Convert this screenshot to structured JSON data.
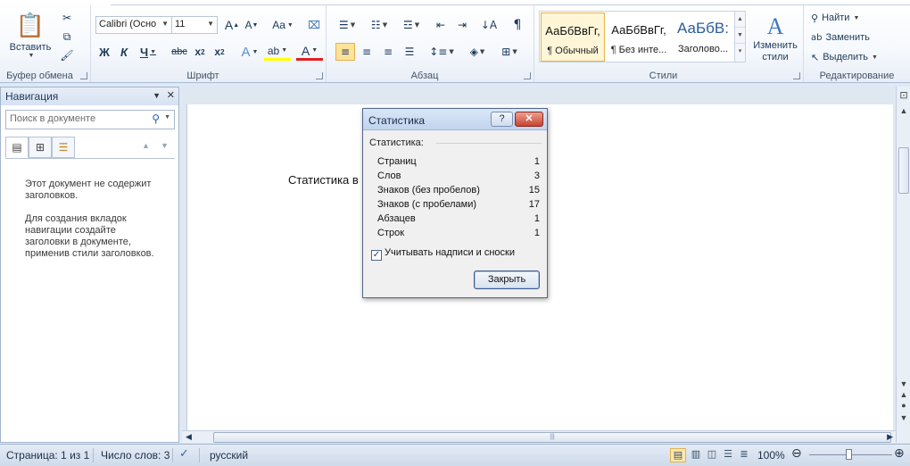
{
  "ribbon": {
    "clipboard": {
      "label": "Буфер обмена",
      "paste": "Вставить"
    },
    "font": {
      "label": "Шрифт",
      "font_name": "Calibri (Осно",
      "font_size": "11"
    },
    "paragraph": {
      "label": "Абзац"
    },
    "styles": {
      "label": "Стили",
      "items": [
        {
          "sample": "АаБбВвГг,",
          "name": "¶ Обычный"
        },
        {
          "sample": "АаБбВвГг,",
          "name": "¶ Без инте..."
        },
        {
          "sample": "АаБбВ:",
          "name": "Заголово..."
        }
      ],
      "change_styles": "Изменить стили"
    },
    "editing": {
      "label": "Редактирование",
      "find": "Найти",
      "replace": "Заменить",
      "select": "Выделить"
    }
  },
  "nav": {
    "title": "Навигация",
    "search_placeholder": "Поиск в документе",
    "msg1": "Этот документ не содержит заголовков.",
    "msg2": "Для создания вкладок навигации создайте заголовки в документе, применив стили заголовков."
  },
  "document": {
    "text": "Статистика в"
  },
  "dialog": {
    "title": "Статистика",
    "section": "Статистика:",
    "stats": [
      {
        "label": "Страниц",
        "value": "1"
      },
      {
        "label": "Слов",
        "value": "3"
      },
      {
        "label": "Знаков (без пробелов)",
        "value": "15"
      },
      {
        "label": "Знаков (с пробелами)",
        "value": "17"
      },
      {
        "label": "Абзацев",
        "value": "1"
      },
      {
        "label": "Строк",
        "value": "1"
      }
    ],
    "checkbox_label": "Учитывать надписи и сноски",
    "checkbox_checked": true,
    "close_button": "Закрыть"
  },
  "status": {
    "page": "Страница: 1 из 1",
    "words": "Число слов: 3",
    "language": "русский",
    "zoom": "100%",
    "zoom_level_percent": 100
  }
}
